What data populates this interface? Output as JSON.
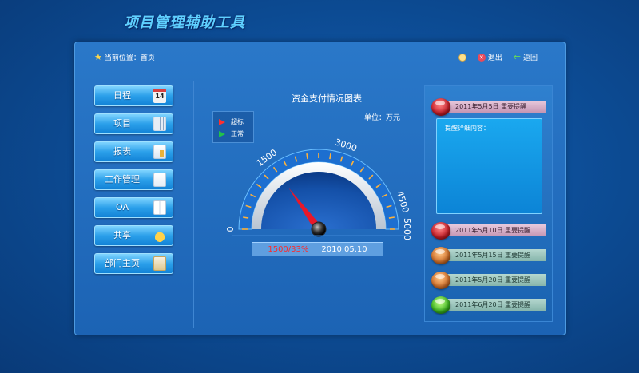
{
  "app": {
    "title": "项目管理辅助工具"
  },
  "topbar": {
    "breadcrumb": "当前位置：首页",
    "exit_label": "退出",
    "back_label": "返回"
  },
  "menu": {
    "items": [
      {
        "label": "日程",
        "icon": "calendar-icon",
        "icon_text": "14"
      },
      {
        "label": "项目",
        "icon": "grid-icon"
      },
      {
        "label": "报表",
        "icon": "report-icon"
      },
      {
        "label": "工作管理",
        "icon": "document-edit-icon"
      },
      {
        "label": "OA",
        "icon": "office-icon"
      },
      {
        "label": "共享",
        "icon": "share-folder-icon"
      },
      {
        "label": "部门主页",
        "icon": "home-icon"
      }
    ]
  },
  "gauge": {
    "title": "资金支付情况图表",
    "unit": "单位：万元",
    "legend": [
      {
        "label": "超标",
        "color": "#ff3030"
      },
      {
        "label": "正常",
        "color": "#22c24a"
      }
    ],
    "min": 0,
    "max": 5000,
    "ticks": [
      "0",
      "1500",
      "3000",
      "4500",
      "5000"
    ],
    "value": 1500,
    "value_text": "1500/33%",
    "date_text": "2010.05.10"
  },
  "reminders": {
    "items": [
      {
        "label": "2011年5月5日 重要提醒",
        "ball": "red",
        "bar": "pink"
      },
      {
        "label": "2011年5月10日 重要提醒",
        "ball": "red",
        "bar": "pink"
      },
      {
        "label": "2011年5月15日 重要提醒",
        "ball": "orange",
        "bar": "teal"
      },
      {
        "label": "2011年5月20日 重要提醒",
        "ball": "orange",
        "bar": "teal"
      },
      {
        "label": "2011年6月20日 重要提醒",
        "ball": "green",
        "bar": "teal"
      }
    ],
    "detail_label": "提醒详细内容："
  },
  "colors": {
    "accent": "#2ba0ea",
    "title": "#5fd0ff",
    "alert": "#ff2a2a"
  }
}
